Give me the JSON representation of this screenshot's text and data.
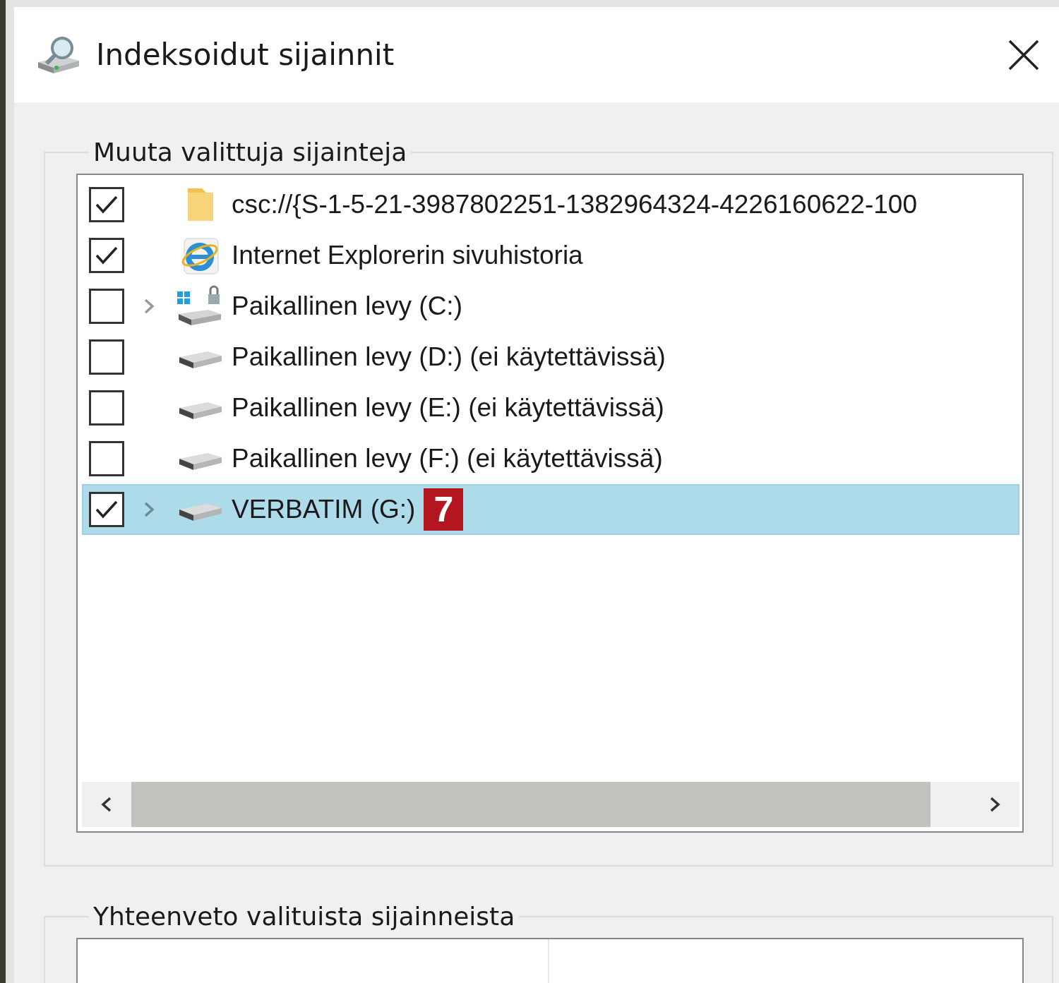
{
  "window": {
    "title": "Indeksoidut sijainnit"
  },
  "locations_group": {
    "legend": "Muuta valittuja sijainteja",
    "items": [
      {
        "label": "csc://{S-1-5-21-3987802251-1382964324-4226160622-100",
        "checked": true,
        "expandable": false,
        "kind": "folder",
        "selected": false
      },
      {
        "label": "Internet Explorerin sivuhistoria",
        "checked": true,
        "expandable": false,
        "kind": "browser",
        "selected": false
      },
      {
        "label": "Paikallinen levy (C:)",
        "checked": false,
        "expandable": true,
        "kind": "system-drive",
        "selected": false
      },
      {
        "label": "Paikallinen levy (D:) (ei käytettävissä)",
        "checked": false,
        "expandable": false,
        "kind": "drive",
        "selected": false
      },
      {
        "label": "Paikallinen levy (E:) (ei käytettävissä)",
        "checked": false,
        "expandable": false,
        "kind": "drive",
        "selected": false
      },
      {
        "label": "Paikallinen levy (F:) (ei käytettävissä)",
        "checked": false,
        "expandable": false,
        "kind": "drive",
        "selected": false
      },
      {
        "label": "VERBATIM (G:)",
        "checked": true,
        "expandable": true,
        "kind": "drive",
        "selected": true,
        "badge": "7"
      }
    ]
  },
  "summary_group": {
    "legend": "Yhteenveto valituista sijainneista"
  }
}
